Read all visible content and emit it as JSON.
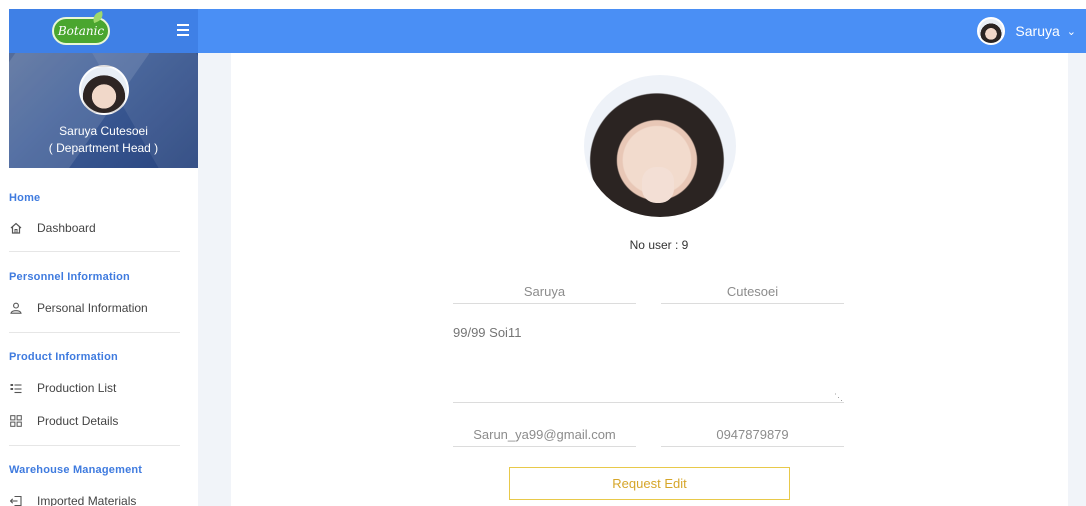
{
  "topbar": {
    "logo_text": "Botanic",
    "user_name": "Saruya",
    "icons": {
      "menu": "hamburger-menu-icon",
      "dropdown": "chevron-down-icon"
    }
  },
  "sidebar": {
    "profile": {
      "name": "Saruya Cutesoei",
      "role": "( Department Head )"
    },
    "sections": [
      {
        "heading": "Home",
        "items": [
          {
            "label": "Dashboard",
            "icon": "home-icon"
          }
        ]
      },
      {
        "heading": "Personnel Information",
        "items": [
          {
            "label": "Personal Information",
            "icon": "user-icon"
          }
        ]
      },
      {
        "heading": "Product Information",
        "items": [
          {
            "label": "Production List",
            "icon": "list-icon"
          },
          {
            "label": "Product Details",
            "icon": "grid-icon"
          }
        ]
      },
      {
        "heading": "Warehouse Management",
        "items": [
          {
            "label": "Imported Materials",
            "icon": "import-icon"
          }
        ]
      }
    ]
  },
  "main": {
    "user_no": "No user : 9",
    "form": {
      "first_name": "Saruya",
      "last_name": "Cutesoei",
      "address": "99/99 Soi11",
      "email": "Sarun_ya99@gmail.com",
      "phone": "0947879879"
    },
    "request_edit_label": "Request Edit"
  },
  "colors": {
    "topbar": "#4a8ff5",
    "nav_heading": "#3f7bdf",
    "button_border": "#e8c94a",
    "button_text": "#d6a62a",
    "content_bg": "#f1f4f9"
  }
}
